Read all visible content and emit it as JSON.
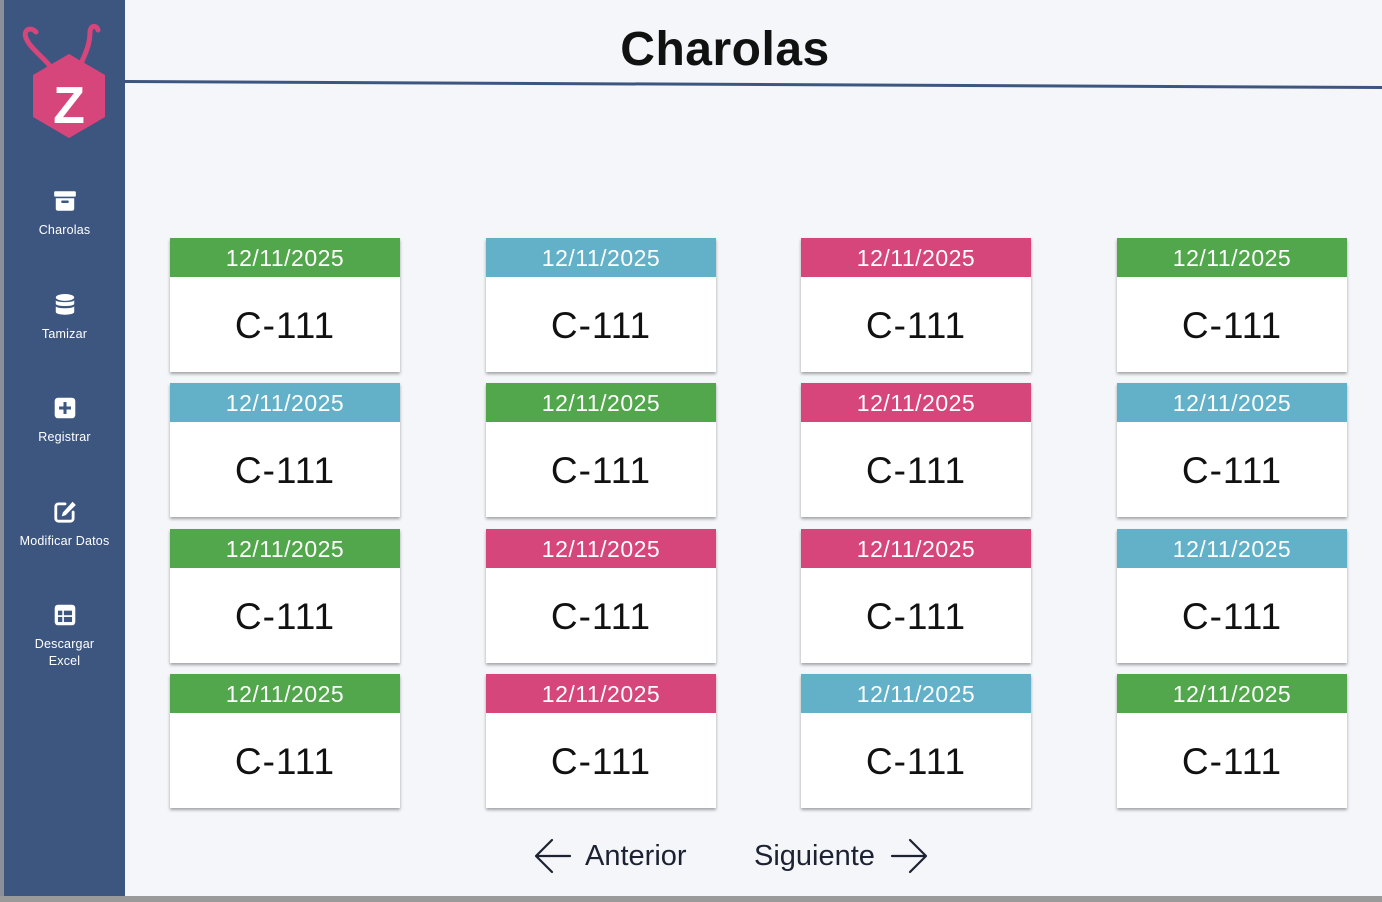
{
  "colors": {
    "sidebar": "#3d5680",
    "background": "#f5f6fa",
    "green": "#52a64b",
    "blue": "#62b1c8",
    "pink": "#d6467b",
    "logo_pink": "#d6467b"
  },
  "logo": {
    "letter": "Z"
  },
  "sidebar": {
    "items": [
      {
        "label": "Charolas",
        "icon": "archive-icon"
      },
      {
        "label": "Tamizar",
        "icon": "database-icon"
      },
      {
        "label": "Registrar",
        "icon": "plus-square-icon"
      },
      {
        "label": "Modificar Datos",
        "icon": "edit-icon"
      },
      {
        "label": "Descargar\nExcel",
        "icon": "table-icon"
      }
    ]
  },
  "header": {
    "title": "Charolas"
  },
  "cards": [
    {
      "date": "12/11/2025",
      "code": "C-111",
      "color": "green"
    },
    {
      "date": "12/11/2025",
      "code": "C-111",
      "color": "blue"
    },
    {
      "date": "12/11/2025",
      "code": "C-111",
      "color": "pink"
    },
    {
      "date": "12/11/2025",
      "code": "C-111",
      "color": "green"
    },
    {
      "date": "12/11/2025",
      "code": "C-111",
      "color": "blue"
    },
    {
      "date": "12/11/2025",
      "code": "C-111",
      "color": "green"
    },
    {
      "date": "12/11/2025",
      "code": "C-111",
      "color": "pink"
    },
    {
      "date": "12/11/2025",
      "code": "C-111",
      "color": "blue"
    },
    {
      "date": "12/11/2025",
      "code": "C-111",
      "color": "green"
    },
    {
      "date": "12/11/2025",
      "code": "C-111",
      "color": "pink"
    },
    {
      "date": "12/11/2025",
      "code": "C-111",
      "color": "pink"
    },
    {
      "date": "12/11/2025",
      "code": "C-111",
      "color": "blue"
    },
    {
      "date": "12/11/2025",
      "code": "C-111",
      "color": "green"
    },
    {
      "date": "12/11/2025",
      "code": "C-111",
      "color": "pink"
    },
    {
      "date": "12/11/2025",
      "code": "C-111",
      "color": "blue"
    },
    {
      "date": "12/11/2025",
      "code": "C-111",
      "color": "green"
    }
  ],
  "pagination": {
    "prev_label": "Anterior",
    "next_label": "Siguiente"
  }
}
